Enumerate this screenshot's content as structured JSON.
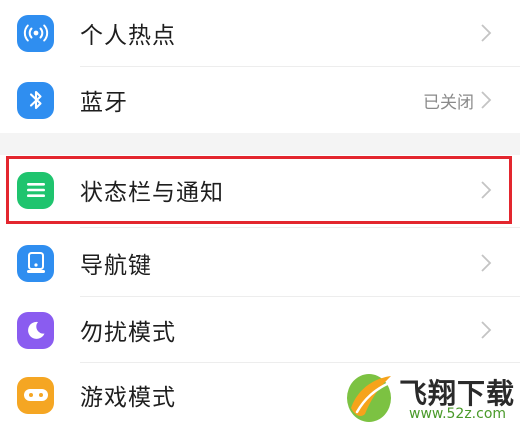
{
  "settings": {
    "items": [
      {
        "label": "个人热点",
        "value": "",
        "icon": "hotspot-icon",
        "icon_color": "#2f8ef0"
      },
      {
        "label": "蓝牙",
        "value": "已关闭",
        "icon": "bluetooth-icon",
        "icon_color": "#2f8ef0"
      },
      {
        "label": "状态栏与通知",
        "value": "",
        "icon": "notification-bar-icon",
        "icon_color": "#1fc46e"
      },
      {
        "label": "导航键",
        "value": "",
        "icon": "navigation-key-icon",
        "icon_color": "#2f8ef0"
      },
      {
        "label": "勿扰模式",
        "value": "",
        "icon": "moon-icon",
        "icon_color": "#8a5cf0"
      },
      {
        "label": "游戏模式",
        "value": "",
        "icon": "gamepad-icon",
        "icon_color": "#f5a623"
      }
    ]
  },
  "highlight": {
    "color": "#e3262e",
    "target": "状态栏与通知"
  },
  "watermark": {
    "title": "飞翔下载",
    "url": "www.52z.com"
  }
}
